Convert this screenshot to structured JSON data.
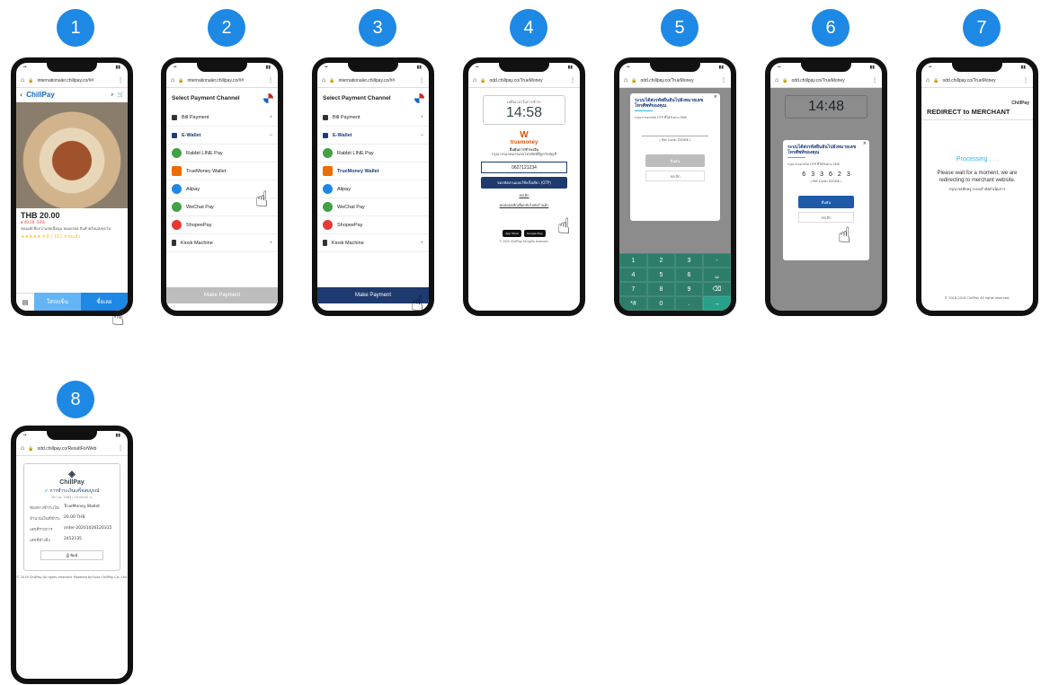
{
  "steps": [
    {
      "number": "1"
    },
    {
      "number": "2"
    },
    {
      "number": "3"
    },
    {
      "number": "4"
    },
    {
      "number": "5"
    },
    {
      "number": "6"
    },
    {
      "number": "7"
    },
    {
      "number": "8"
    }
  ],
  "screen1": {
    "url": "internationaler.chillpay.co/##",
    "logo": "ChillPay",
    "price": "THB 20.00",
    "old_price": "฿ 40.00 -50%",
    "desc": "ขนมเค้กช็อกโกแลตเนื้อนุ่ม หอมอร่อย สินค้าพร้อมส่งทุกวัน",
    "stars": "★★★★★ 4.8 | 102 ขายแล้ว",
    "add_label": "ใส่รถเข็น",
    "buy_label": "ซื้อเลย"
  },
  "payment": {
    "url": "internationaler.chillpay.co/##",
    "title": "Select Payment Channel",
    "rows": [
      {
        "label": "Bill Payment",
        "color": "#333"
      },
      {
        "label": "E-Wallet",
        "color": "#1a3d7c"
      },
      {
        "label": "Rabbit LINE Pay",
        "color": "#43a047"
      },
      {
        "label": "TrueMoney Wallet",
        "color": "#ef6c00"
      },
      {
        "label": "Alipay",
        "color": "#1e88e5"
      },
      {
        "label": "WeChat Pay",
        "color": "#43a047"
      },
      {
        "label": "ShopeePay",
        "color": "#e53935"
      },
      {
        "label": "Kiosk Machine",
        "color": "#333"
      }
    ],
    "button": "Make Payment"
  },
  "screen4": {
    "url": "odd.chillpay.co/TrueMoney",
    "timer_label": "เหลือเวลาในการชำระ",
    "timer": "14:58",
    "brand": "truemoney",
    "pay_title": "ยืนยันการชำระเงิน",
    "pay_text": "กรุณากรอกหมายเลขโทรศัพท์ที่ผูกกับบัญชี",
    "phone": "0627121234",
    "otp_btn": "ขอรหัสผ่านแบบใช้ครั้งเดียว (OTP)",
    "cancel": "ยกเลิก",
    "back": "ทดสอบคลิกเพื่อกลับไปยังร้านค้า",
    "app_store": "App Store",
    "play": "Google Play",
    "footer": "© 2020 ChillPay All rights reserved."
  },
  "screen5": {
    "url": "odd.chillpay.co/TrueMoney",
    "modal_title": "ระบบได้ส่งรหัสยืนยันไปยังหมายเลขโทรศัพท์ของคุณ",
    "modal_sub": "กรุณากรอกรหัส OTP ที่ได้รับทาง SMS",
    "ref": "( Ref Code: DV2BK )",
    "confirm": "ยืนยัน",
    "cancel": "ยกเลิก",
    "keys": [
      "1",
      "2",
      "3",
      "-",
      "4",
      "5",
      "6",
      "␣",
      "7",
      "8",
      "9",
      "⌫",
      "*#",
      "0",
      ".",
      "→"
    ]
  },
  "screen6": {
    "url": "odd.chillpay.co/TrueMoney",
    "timer": "14:48",
    "modal_title": "ระบบได้ส่งรหัสยืนยันไปยังหมายเลขโทรศัพท์ของคุณ",
    "modal_sub": "กรุณากรอกรหัส OTP ที่ได้รับทาง SMS",
    "digits": [
      "6",
      "3",
      "3",
      "6",
      "2",
      "3"
    ],
    "ref": "( Ref Code: DV2BK )",
    "confirm": "ยืนยัน",
    "cancel": "ยกเลิก"
  },
  "screen7": {
    "url": "odd.chillpay.co/TrueMoney",
    "logo": "ChillPay",
    "title": "REDIRECT to MERCHANT",
    "processing": "Processing . . .",
    "message": "Please wait for a moment, we are redirecting to merchant website.",
    "message_th": "กรุณารอสักครู่ ระบบกำลังดำเนินการ",
    "footer": "© 2018-2019 ChillPay All rights reserved."
  },
  "screen8": {
    "url": "odd.chillpay.co/ResultForWeb",
    "logo": "ChillPay",
    "success": "การชำระเงินเสร็จสมบูรณ์",
    "date": "26 ก.ค. 2563 | 10:00:42 น.",
    "rows": [
      {
        "k": "ช่องทางชำระเงิน",
        "v": "TrueMoney Wallet"
      },
      {
        "k": "จำนวนเงินที่ชำระ",
        "v": "20.00 THB"
      },
      {
        "k": "เลขที่รายการ",
        "v": "order-20201026120315"
      },
      {
        "k": "เลขที่อ้างอิง",
        "v": "2452135"
      }
    ],
    "print": "พิมพ์",
    "footer": "© 2019 ChillPay All rights reserved. Powered by Fuse ChillPay Co., Ltd."
  },
  "colors": {
    "accent": "#1e88e5",
    "dark_blue": "#1e3a6e",
    "keypad": "#2e7d6b"
  }
}
